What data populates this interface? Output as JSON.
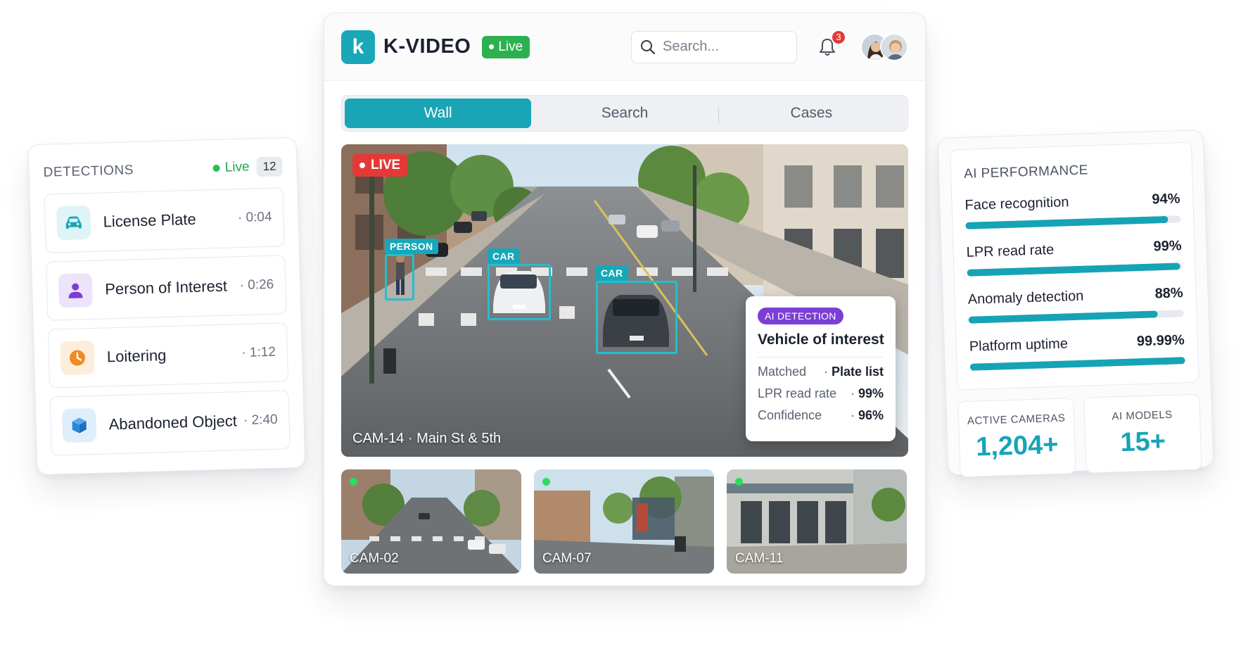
{
  "detections": {
    "title": "DETECTIONS",
    "live_label": "Live",
    "count": "12",
    "items": [
      {
        "label": "License Plate",
        "time": "· 0:04",
        "icon": "car-icon",
        "color": "#1aa7b8",
        "bg": "#dff4f6"
      },
      {
        "label": "Person of Interest",
        "time": "· 0:26",
        "icon": "person-icon",
        "color": "#7b3fd4",
        "bg": "#ede4fb"
      },
      {
        "label": "Loitering",
        "time": "· 1:12",
        "icon": "clock-icon",
        "color": "#f08a24",
        "bg": "#fdeedc"
      },
      {
        "label": "Abandoned Object",
        "time": "· 2:40",
        "icon": "box-icon",
        "color": "#2a86d8",
        "bg": "#e0eefb"
      }
    ]
  },
  "header": {
    "logo_letter": "k",
    "brand": "K-VIDEO",
    "live_label": "Live",
    "search_placeholder": "Search...",
    "notification_count": "3"
  },
  "tabs": [
    {
      "label": "Wall",
      "active": true
    },
    {
      "label": "Search",
      "active": false
    },
    {
      "label": "Cases",
      "active": false
    }
  ],
  "feed": {
    "live_tag": "LIVE",
    "camera_caption": "CAM-14 · Main St & 5th",
    "boxes": [
      {
        "label": "PERSON"
      },
      {
        "label": "CAR"
      },
      {
        "label": "CAR"
      }
    ],
    "ai_popup": {
      "chip": "AI DETECTION",
      "title": "Vehicle of interest",
      "rows": [
        {
          "key": "Matched",
          "value": "Plate list"
        },
        {
          "key": "LPR read rate",
          "value": "99%"
        },
        {
          "key": "Confidence",
          "value": "96%"
        }
      ]
    }
  },
  "thumbnails": [
    {
      "caption": "CAM-02"
    },
    {
      "caption": "CAM-07"
    },
    {
      "caption": "CAM-11"
    }
  ],
  "performance": {
    "title": "AI PERFORMANCE",
    "metrics": [
      {
        "label": "Face recognition",
        "value": "94%",
        "fill": 0.94
      },
      {
        "label": "LPR read rate",
        "value": "99%",
        "fill": 0.99
      },
      {
        "label": "Anomaly detection",
        "value": "88%",
        "fill": 0.88
      },
      {
        "label": "Platform uptime",
        "value": "99.99%",
        "fill": 0.9999
      }
    ],
    "stats": [
      {
        "label": "ACTIVE CAMERAS",
        "value": "1,204+"
      },
      {
        "label": "AI MODELS",
        "value": "15+"
      }
    ]
  },
  "colors": {
    "accent": "#19a5b6",
    "live_green": "#2cb150",
    "alert_red": "#e53935",
    "ai_purple": "#7b3fd4"
  }
}
